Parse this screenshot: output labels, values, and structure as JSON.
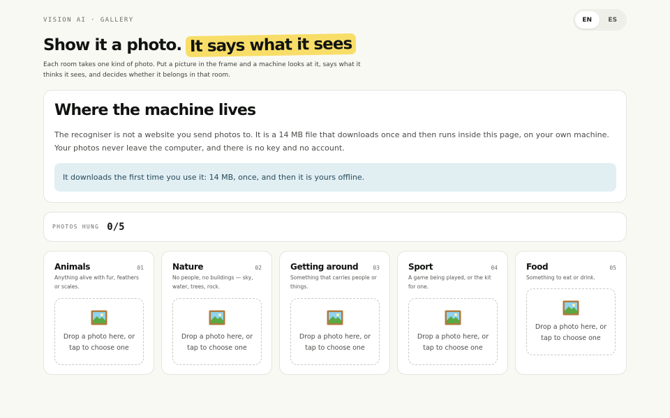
{
  "header": {
    "kicker": "VISION AI · GALLERY",
    "lang_options": [
      "EN",
      "ES"
    ],
    "lang_selected": "EN"
  },
  "hero": {
    "title_plain": "Show it a photo.",
    "title_highlight": "It says what it sees",
    "highlight_color": "#f8de68",
    "intro": "Each room takes one kind of photo. Put a picture in the frame and a machine looks at it, says what it thinks it sees, and decides whether it belongs in that room."
  },
  "machine": {
    "title": "Where the machine lives",
    "body": "The recogniser is not a website you send photos to. It is a 14 MB file that downloads once and then runs inside this page, on your own machine. Your photos never leave the computer, and there is no key and no account.",
    "notice": "It downloads the first time you use it: 14 MB, once, and then it is yours offline."
  },
  "counter": {
    "label": "PHOTOS HUNG",
    "value": "0/5"
  },
  "drop_text": "Drop a photo here, or tap to choose one",
  "rooms": [
    {
      "title": "Animals",
      "num": "01",
      "desc": "Anything alive with fur, feathers or scales.",
      "icon": "framed-picture-icon"
    },
    {
      "title": "Nature",
      "num": "02",
      "desc": "No people, no buildings — sky, water, trees, rock.",
      "icon": "framed-picture-icon"
    },
    {
      "title": "Getting around",
      "num": "03",
      "desc": "Something that carries people or things.",
      "icon": "framed-picture-icon"
    },
    {
      "title": "Sport",
      "num": "04",
      "desc": "A game being played, or the kit for one.",
      "icon": "framed-picture-icon"
    },
    {
      "title": "Food",
      "num": "05",
      "desc": "Something to eat or drink.",
      "icon": "framed-picture-icon"
    }
  ]
}
